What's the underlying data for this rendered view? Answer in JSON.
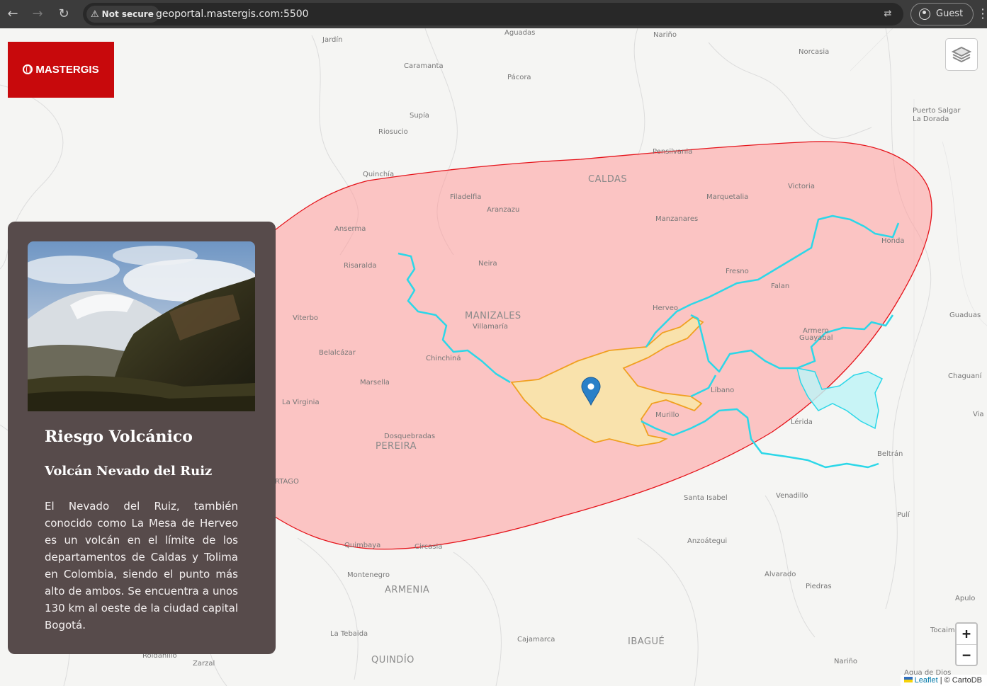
{
  "browser": {
    "security_label": "Not secure",
    "url": "geoportal.mastergis.com:5500",
    "profile_label": "Guest"
  },
  "logo": {
    "text": "MASTERGIS"
  },
  "map": {
    "places": {
      "jardin": "Jardín",
      "aguadas": "Aguadas",
      "narino_n": "Nariño",
      "caramanta": "Caramanta",
      "pacora": "Pácora",
      "norcasia": "Norcasia",
      "supia": "Supía",
      "riosucio": "Riosucio",
      "puerto_salgar": "Puerto Salgar",
      "la_dorada": "La Dorada",
      "pensilvania": "Pensilvania",
      "quinchia": "Quinchía",
      "caldas": "CALDAS",
      "filadelfia": "Filadelfia",
      "marquetalia": "Marquetalia",
      "victoria": "Victoria",
      "aranzazu": "Aranzazu",
      "anserma": "Anserma",
      "manzanares": "Manzanares",
      "honda": "Honda",
      "risaralda": "Risaralda",
      "neira": "Neira",
      "fresno": "Fresno",
      "falan": "Falan",
      "viterbo": "Viterbo",
      "manizales": "MANIZALES",
      "villamaria": "Villamaría",
      "herveo": "Herveo",
      "guaduas": "Guaduas",
      "armero": "Armero",
      "guayabal": "Guayabal",
      "belalcazar": "Belalcázar",
      "chinchina": "Chinchiná",
      "chaguani": "Chaguaní",
      "marsella": "Marsella",
      "libano": "Líbano",
      "la_virginia": "La Virginia",
      "murillo": "Murillo",
      "lerida": "Lérida",
      "dosquebradas": "Dosquebradas",
      "pereira": "PEREIRA",
      "beltran": "Beltrán",
      "cartago": "RTAGO",
      "santa_isabel": "Santa Isabel",
      "venadillo": "Venadillo",
      "puli": "Pulí",
      "quimbaya": "Quimbaya",
      "circasia": "Circasia",
      "anzoategui": "Anzoátegui",
      "montenegro": "Montenegro",
      "alvarado": "Alvarado",
      "armenia": "ARMENIA",
      "piedras": "Piedras",
      "apulo": "Apulo",
      "la_tebaida": "La Tebaida",
      "tocaima": "Tocaim",
      "cajamarca": "Cajamarca",
      "ibague": "IBAGUÉ",
      "roldanillo": "Roldanillo",
      "zarzal": "Zarzal",
      "quindio": "QUINDÍO",
      "narino_s": "Nariño",
      "agua_de_dios": "Agua de Dios",
      "via": "Via"
    },
    "colors": {
      "risk_fill": "#ff9b9b",
      "risk_stroke": "#e5131a",
      "lahar_fill": "#f8e8a8",
      "lahar_stroke": "#f0a020",
      "river_stroke": "#2cd7e8",
      "marker": "#2a80c8"
    }
  },
  "controls": {
    "zoom_in": "+",
    "zoom_out": "−",
    "attribution_leaflet": "Leaflet",
    "attribution_rest": "| © CartoDB"
  },
  "panel": {
    "title": "Riesgo Volcánico",
    "subtitle": "Volcán Nevado del Ruiz",
    "description": "El Nevado del Ruiz, también conocido como La Mesa de Herveo es un volcán en el límite de los departamentos de Caldas y Tolima en Colombia, siendo el punto más alto de ambos. Se encuentra a unos 130 km al oeste de la ciudad capital Bogotá."
  }
}
